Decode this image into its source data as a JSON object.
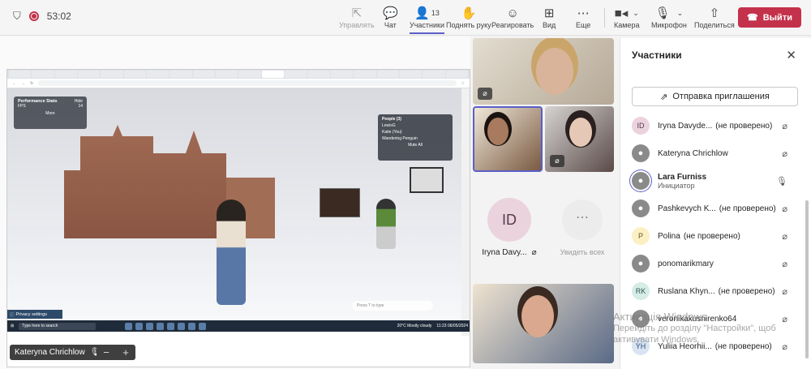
{
  "toolbar": {
    "timer": "53:02",
    "buttons": {
      "share": "Управлять",
      "chat": "Чат",
      "participants": "Участники",
      "participants_count": "13",
      "raise_hand": "Поднять руку",
      "react": "Реагировать",
      "view": "Вид",
      "more": "Еще",
      "camera": "Камера",
      "mic": "Микрофон",
      "share_screen": "Поделиться"
    },
    "leave": "Выйти"
  },
  "stage": {
    "presenter_name": "Kateryna Chrichlow",
    "screen": {
      "perf_title": "Performance Stats",
      "perf_hide": "Hide",
      "perf_fps": "FPS",
      "perf_fps_val": "14",
      "perf_more": "More",
      "people_title": "People (3)",
      "people": [
        "LewisG",
        "Katie (You)",
        "Wandering Penguin"
      ],
      "mute_all": "Mute All",
      "privacy": "Privacy settings",
      "typebox": "Press T to type",
      "taskbar_search": "Type here to search",
      "weather": "20°C  Mostly cloudy",
      "time": "11:23",
      "date": "06/05/2024"
    }
  },
  "tiles": {
    "id_initials": "ID",
    "id_name": "Iryna Davy...",
    "see_all": "Увидеть всех"
  },
  "panel": {
    "title": "Участники",
    "invite": "Отправка приглашения",
    "participants": [
      {
        "initials": "ID",
        "name": "Iryna Davyde...",
        "status": "(не проверено)",
        "avatar_color": "#ebd3de",
        "avatar_text": "#5a3a4a"
      },
      {
        "initials": "",
        "name": "Kateryna Chrichlow",
        "status": "",
        "avatar_color": "#8a8a8a",
        "avatar_text": "#ffffff"
      },
      {
        "initials": "",
        "name": "Lara Furniss",
        "status": "",
        "role": "Инициатор",
        "avatar_color": "#8a8a8a",
        "avatar_text": "#ffffff"
      },
      {
        "initials": "",
        "name": "Pashkevych K...",
        "status": "(не проверено)",
        "avatar_color": "#8a8a8a",
        "avatar_text": "#ffffff"
      },
      {
        "initials": "P",
        "name": "Polina",
        "status": "(не проверено)",
        "avatar_color": "#fbefc4",
        "avatar_text": "#6b5414"
      },
      {
        "initials": "",
        "name": "ponomarikmary",
        "status": "",
        "avatar_color": "#8a8a8a",
        "avatar_text": "#ffffff"
      },
      {
        "initials": "RK",
        "name": "Ruslana Khyn...",
        "status": "(не проверено)",
        "avatar_color": "#d6ece6",
        "avatar_text": "#2e5a4e"
      },
      {
        "initials": "",
        "name": "veronikakusnirenko64",
        "status": "",
        "avatar_color": "#8a8a8a",
        "avatar_text": "#ffffff"
      },
      {
        "initials": "YH",
        "name": "Yuliia Heorhii...",
        "status": "(не проверено)",
        "avatar_color": "#d8e4f2",
        "avatar_text": "#2a4a72"
      }
    ]
  },
  "watermark": {
    "line1": "Активація Windows",
    "line2": "Перейдіть до розділу \"Настройки\", щоб",
    "line3": "активувати Windows."
  }
}
